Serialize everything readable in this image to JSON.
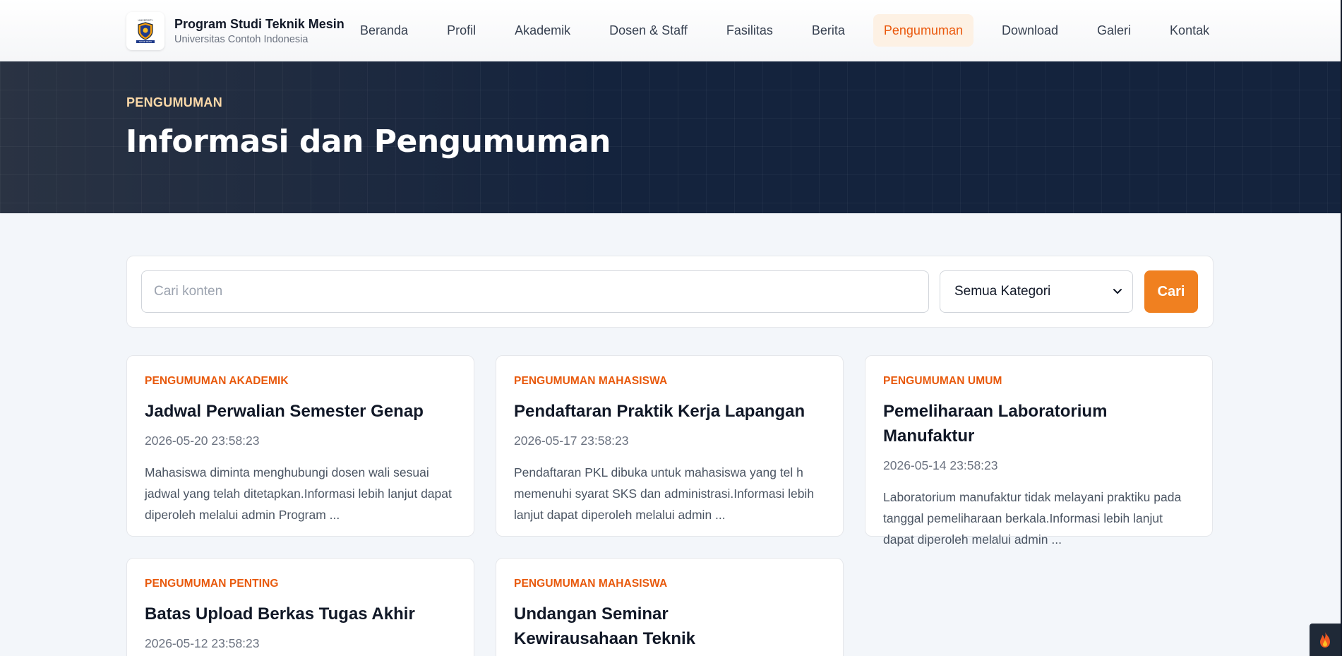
{
  "brand": {
    "title": "Program Studi Teknik Mesin",
    "subtitle": "Universitas Contoh Indonesia",
    "logo_icon": "university-shield-logo"
  },
  "nav": {
    "items": [
      {
        "label": "Beranda"
      },
      {
        "label": "Profil"
      },
      {
        "label": "Akademik"
      },
      {
        "label": "Dosen & Staff"
      },
      {
        "label": "Fasilitas"
      },
      {
        "label": "Berita"
      },
      {
        "label": "Pengumuman",
        "active": true
      },
      {
        "label": "Download"
      },
      {
        "label": "Galeri"
      },
      {
        "label": "Kontak"
      }
    ],
    "active_color": "#ea580c"
  },
  "hero": {
    "kicker": "PENGUMUMAN",
    "title": "Informasi dan Pengumuman",
    "background": "#14233d"
  },
  "search": {
    "placeholder": "Cari konten",
    "value": "",
    "category_selected": "Semua Kategori",
    "button_label": "Cari",
    "button_color": "#f08020"
  },
  "announcements": [
    {
      "category": "PENGUMUMAN AKADEMIK",
      "title": "Jadwal Perwalian Semester Genap",
      "date": "2026-05-20 23:58:23",
      "excerpt": "Mahasiswa diminta menghubungi dosen wali sesuai jadwal yang telah ditetapkan.Informasi lebih lanjut dapat diperoleh melalui admin Program ..."
    },
    {
      "category": "PENGUMUMAN MAHASISWA",
      "title": "Pendaftaran Praktik Kerja Lapangan",
      "date": "2026-05-17 23:58:23",
      "excerpt": "Pendaftaran PKL dibuka untuk mahasiswa yang tel h memenuhi syarat SKS dan administrasi.Informasi lebih lanjut dapat diperoleh melalui admin ..."
    },
    {
      "category": "PENGUMUMAN UMUM",
      "title": "Pemeliharaan Laboratorium Manufaktur",
      "date": "2026-05-14 23:58:23",
      "excerpt": "Laboratorium manufaktur tidak melayani praktiku pada tanggal pemeliharaan berkala.Informasi lebih lanjut dapat diperoleh melalui admin ..."
    },
    {
      "category": "PENGUMUMAN PENTING",
      "title": "Batas Upload Berkas Tugas Akhir",
      "date": "2026-05-12 23:58:23",
      "excerpt": ""
    },
    {
      "category": "PENGUMUMAN MAHASISWA",
      "title": "Undangan Seminar Kewirausahaan Teknik",
      "date": "",
      "excerpt": ""
    }
  ],
  "corner_badge_icon": "flame-icon"
}
